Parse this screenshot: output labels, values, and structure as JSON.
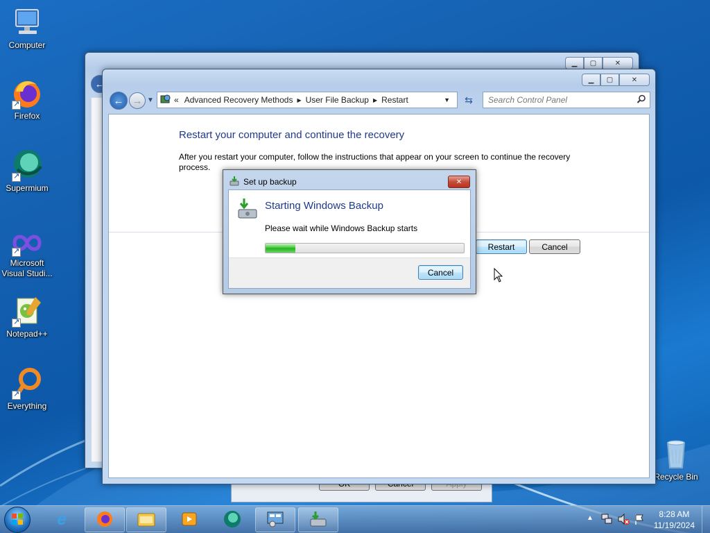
{
  "desktop": {
    "icons": [
      {
        "label": "Computer"
      },
      {
        "label": "Firefox"
      },
      {
        "label": "Supermium"
      },
      {
        "label": "Microsoft Visual Studi..."
      },
      {
        "label": "Notepad++"
      },
      {
        "label": "Everything"
      },
      {
        "label": "Recycle Bin"
      }
    ]
  },
  "back_window": {
    "buttons": {
      "ok": "OK",
      "cancel": "Cancel",
      "apply": "Apply"
    }
  },
  "main_window": {
    "breadcrumb": [
      "Advanced Recovery Methods",
      "User File Backup",
      "Restart"
    ],
    "search_placeholder": "Search Control Panel",
    "heading": "Restart your computer and continue the recovery",
    "description": "After you restart your computer, follow the instructions that appear on your screen to continue the recovery process.",
    "restart_label": "Restart",
    "cancel_label": "Cancel"
  },
  "dialog": {
    "title": "Set up backup",
    "heading": "Starting Windows Backup",
    "message": "Please wait while Windows Backup starts",
    "progress": 0.15,
    "cancel_label": "Cancel"
  },
  "taskbar": {
    "time": "8:28 AM",
    "date": "11/19/2024"
  },
  "colors": {
    "heading_blue": "#1e3a8a",
    "progress_green": "#2bb523"
  }
}
